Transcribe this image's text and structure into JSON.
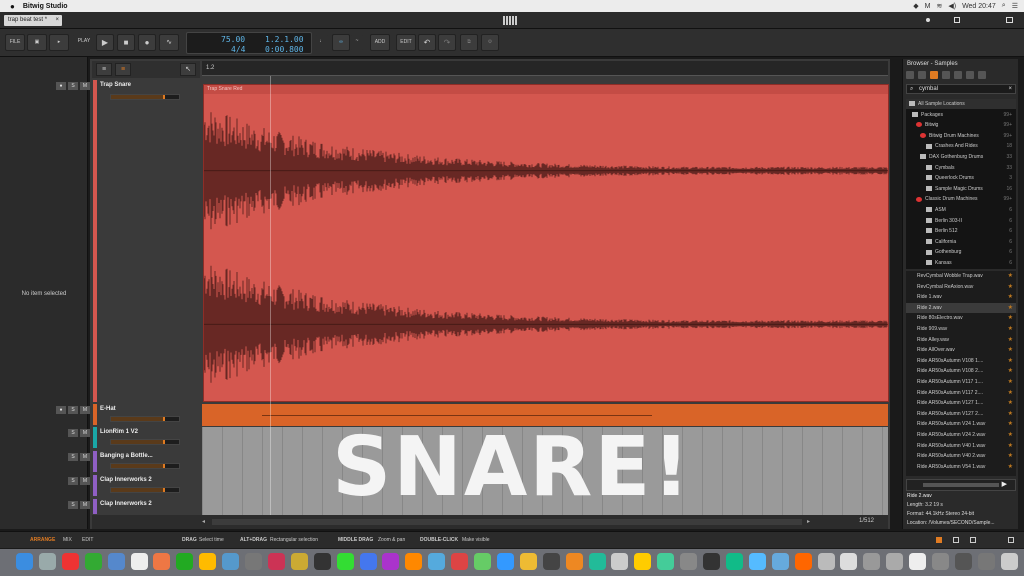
{
  "menubar": {
    "apple": "",
    "app_name": "Bitwig Studio",
    "clock": "Wed 20:47"
  },
  "tab": {
    "label": "trap beat test *",
    "close": "×"
  },
  "transport": {
    "file": "FILE",
    "play_label": "PLAY",
    "add": "ADD",
    "edit": "EDIT",
    "tempo": "75.00",
    "time_sig": "4/4",
    "position": "1.2.1.00",
    "time": "0:00.800"
  },
  "left_panel": {
    "message": "No item selected"
  },
  "ruler": {
    "position_label": "1.2"
  },
  "tracks": [
    {
      "name": "Trap Snare",
      "color": "#d4574f"
    },
    {
      "name": "E-Hat",
      "color": "#d96428"
    },
    {
      "name": "LionRim 1 V2",
      "color": "#1aa7a7"
    },
    {
      "name": "Banging a Bottle...",
      "color": "#8f5fc4"
    },
    {
      "name": "Clap Innerworks 2",
      "color": "#8f5fc4"
    },
    {
      "name": "Clap Innerworks 2",
      "color": "#8f5fc4"
    }
  ],
  "track_buttons": {
    "s": "S",
    "m": "M"
  },
  "clip": {
    "name": "Trap Snare Red"
  },
  "overlay_text": "SNARE!",
  "zoom": "1/512",
  "browser": {
    "title": "Browser - Samples",
    "search": "cymbal",
    "locations": [
      {
        "label": "All Sample Locations",
        "count": ""
      },
      {
        "label": "Packages",
        "count": "99+"
      },
      {
        "label": "Bitwig",
        "count": "99+"
      },
      {
        "label": "Bitwig Drum Machines",
        "count": "99+"
      },
      {
        "label": "Crashes And Rides",
        "count": "18"
      },
      {
        "label": "DAX Gothenburg Drums",
        "count": "33"
      },
      {
        "label": "Cymbals",
        "count": "33"
      },
      {
        "label": "Queerlock Drums",
        "count": "3"
      },
      {
        "label": "Sample Magic Drums",
        "count": "16"
      },
      {
        "label": "Classic Drum Machines",
        "count": "99+"
      },
      {
        "label": "ASM",
        "count": "6"
      },
      {
        "label": "Berlin 303-II",
        "count": "6"
      },
      {
        "label": "Berlin 512",
        "count": "6"
      },
      {
        "label": "California",
        "count": "6"
      },
      {
        "label": "Gothenburg",
        "count": "6"
      },
      {
        "label": "Kansas",
        "count": "6"
      }
    ],
    "files": [
      "RevCymbal Wobble Trap.wav",
      "RevCymbal ReAxion.wav",
      "Ride 1.wav",
      "Ride 2.wav",
      "Ride 80sElectro.wav",
      "Ride 909.wav",
      "Ride Alley.wav",
      "Ride AllOver.wav",
      "Ride AR50sAutumn V108 1....",
      "Ride AR50sAutumn V108 2....",
      "Ride AR50sAutumn V117 1....",
      "Ride AR50sAutumn V117 2....",
      "Ride AR50sAutumn V127 1....",
      "Ride AR50sAutumn V127 2....",
      "Ride AR50sAutumn V24 1.wav",
      "Ride AR50sAutumn V24 2.wav",
      "Ride AR50sAutumn V40 1.wav",
      "Ride AR50sAutumn V40 2.wav",
      "Ride AR50sAutumn V54 1.wav"
    ],
    "selected_file_index": 3,
    "info": {
      "name": "Ride 2.wav",
      "length": "Length: 3.2 19 s",
      "format": "Format: 44.1kHz Stereo 24-bit",
      "location": "Location: /Volumes/SECOND/Sample..."
    }
  },
  "statusbar": {
    "arrange": "ARRANGE",
    "mix": "MIX",
    "edit": "EDIT",
    "drag": "DRAG",
    "drag_desc": "Select time",
    "altdrag": "ALT+DRAG",
    "altdrag_desc": "Rectangular selection",
    "middle": "MIDDLE DRAG",
    "middle_desc": "Zoom & pan",
    "dbl": "DOUBLE-CLICK",
    "dbl_desc": "Make visible"
  },
  "colors": {
    "accent": "#e07b22",
    "lcd": "#5fb6e8",
    "clip": "#d4574f"
  }
}
